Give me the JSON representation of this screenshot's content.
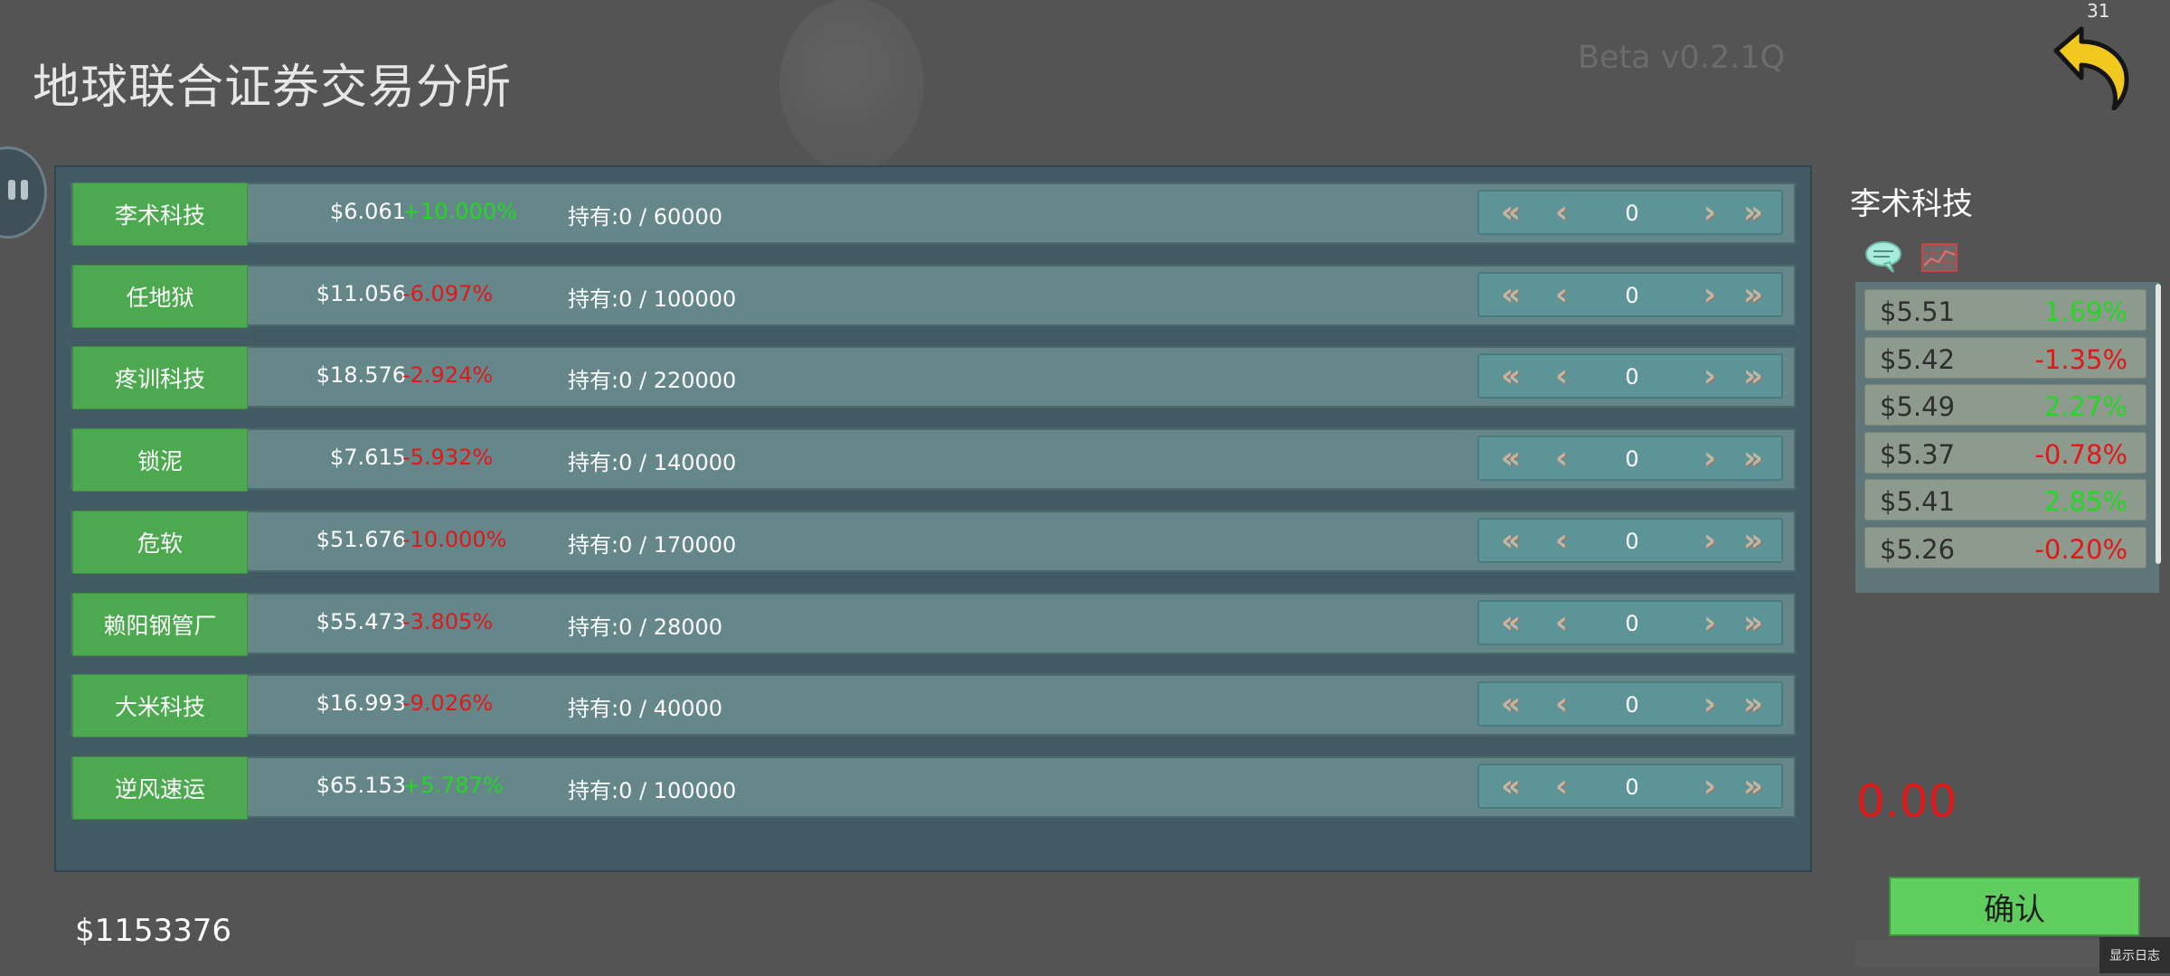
{
  "header": {
    "title": "地球联合证券交易分所",
    "version": "Beta v0.2.1Q",
    "fps": "31",
    "back_icon": "undo-arrow-icon"
  },
  "colors": {
    "positive": "#22d822",
    "negative": "#e01818",
    "name_button": "#4ca94f",
    "confirm_button": "#5fce5f"
  },
  "holding_label": "持有:",
  "stocks": [
    {
      "name": "李术科技",
      "price": "$6.061",
      "change": "+10.000%",
      "trend": "up",
      "holding": "0 / 60000",
      "qty": "0"
    },
    {
      "name": "任地狱",
      "price": "$11.056",
      "change": "-6.097%",
      "trend": "down",
      "holding": "0 / 100000",
      "qty": "0"
    },
    {
      "name": "疼训科技",
      "price": "$18.576",
      "change": "-2.924%",
      "trend": "down",
      "holding": "0 / 220000",
      "qty": "0"
    },
    {
      "name": "锁泥",
      "price": "$7.615",
      "change": "-5.932%",
      "trend": "down",
      "holding": "0 / 140000",
      "qty": "0"
    },
    {
      "name": "危软",
      "price": "$51.676",
      "change": "-10.000%",
      "trend": "down",
      "holding": "0 / 170000",
      "qty": "0"
    },
    {
      "name": "赖阳钢管厂",
      "price": "$55.473",
      "change": "-3.805%",
      "trend": "down",
      "holding": "0 / 28000",
      "qty": "0"
    },
    {
      "name": "大米科技",
      "price": "$16.993",
      "change": "-9.026%",
      "trend": "down",
      "holding": "0 / 40000",
      "qty": "0"
    },
    {
      "name": "逆风速运",
      "price": "$65.153",
      "change": "+5.787%",
      "trend": "up",
      "holding": "0 / 100000",
      "qty": "0"
    }
  ],
  "detail": {
    "title": "李术科技",
    "icons": [
      "chat-bubble-icon",
      "chart-icon"
    ],
    "history": [
      {
        "price": "$5.51",
        "change": "1.69%",
        "trend": "up"
      },
      {
        "price": "$5.42",
        "change": "-1.35%",
        "trend": "down"
      },
      {
        "price": "$5.49",
        "change": "2.27%",
        "trend": "up"
      },
      {
        "price": "$5.37",
        "change": "-0.78%",
        "trend": "down"
      },
      {
        "price": "$5.41",
        "change": "2.85%",
        "trend": "up"
      },
      {
        "price": "$5.26",
        "change": "-0.20%",
        "trend": "down"
      }
    ],
    "total": "0.00",
    "confirm_label": "确认"
  },
  "money": "$1153376",
  "log_button": "显示日志"
}
